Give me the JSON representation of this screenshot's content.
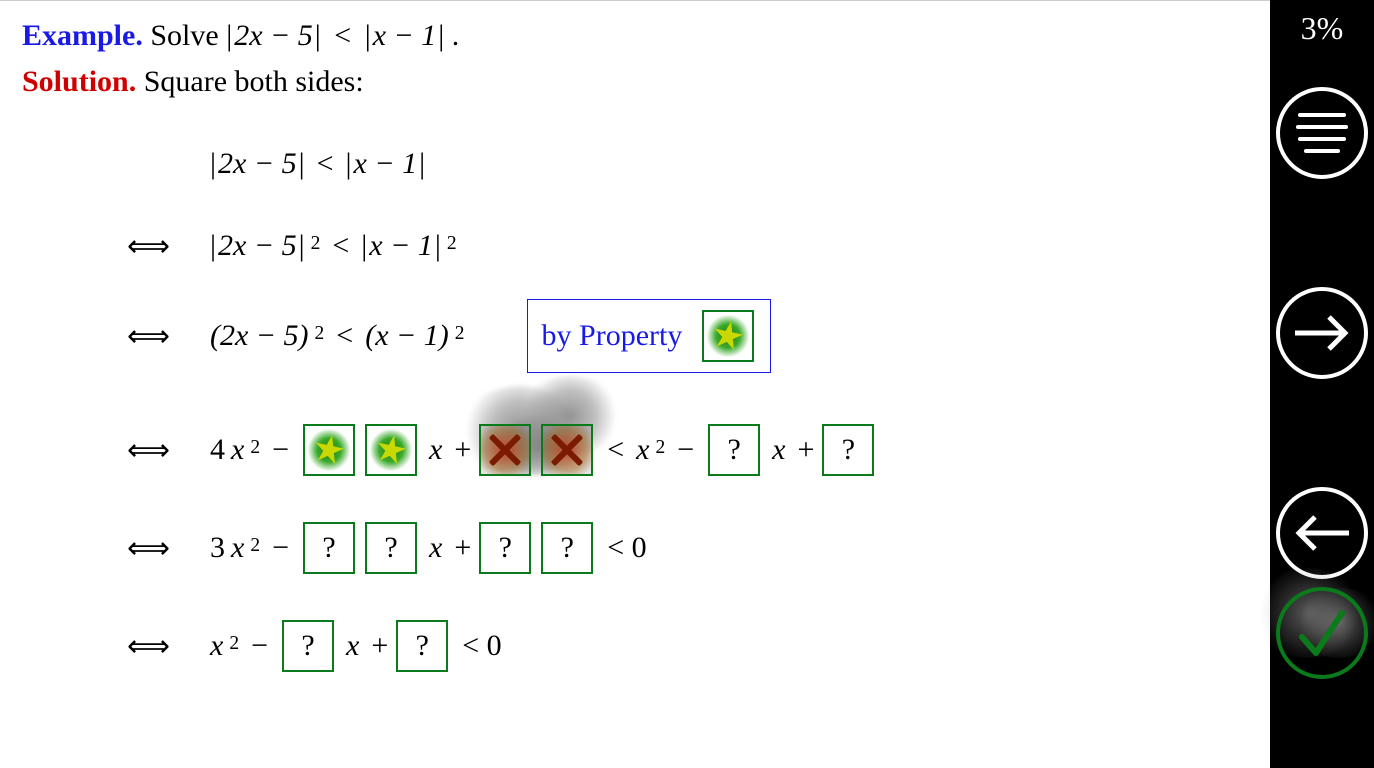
{
  "header": {
    "example_label": "Example.",
    "example_text_prefix": "Solve ",
    "example_lhs": "2x − 5",
    "example_rhs": "x − 1",
    "example_text_suffix": " .",
    "solution_label": "Solution.",
    "solution_text": "Square both sides:"
  },
  "lines": {
    "l1": {
      "lhs_inner": "2x − 5",
      "rhs_inner": "x − 1"
    },
    "l2": {
      "lhs_inner": "2x − 5",
      "rhs_inner": "x − 1",
      "power": "2"
    },
    "l3": {
      "lhs": "(2x − 5)",
      "rhs": "(x − 1)",
      "power": "2",
      "prop_label": "by Property"
    },
    "l4": {
      "a": "4",
      "x2": "x",
      "p2": "2",
      "m1": "−",
      "mid": "x +",
      "lt": "<",
      "r1": "x",
      "rp2": "2",
      "rm": "−",
      "rmid": "x +",
      "q": "?"
    },
    "l5": {
      "a": "3",
      "x2": "x",
      "p2": "2",
      "m1": "−",
      "mid": "x +",
      "lt": "< 0",
      "q": "?"
    },
    "l6": {
      "x2": "x",
      "p2": "2",
      "m1": "−",
      "mid": "x +",
      "lt": "< 0",
      "q": "?"
    }
  },
  "sidebar": {
    "score": "3%"
  },
  "iff": "⟺"
}
